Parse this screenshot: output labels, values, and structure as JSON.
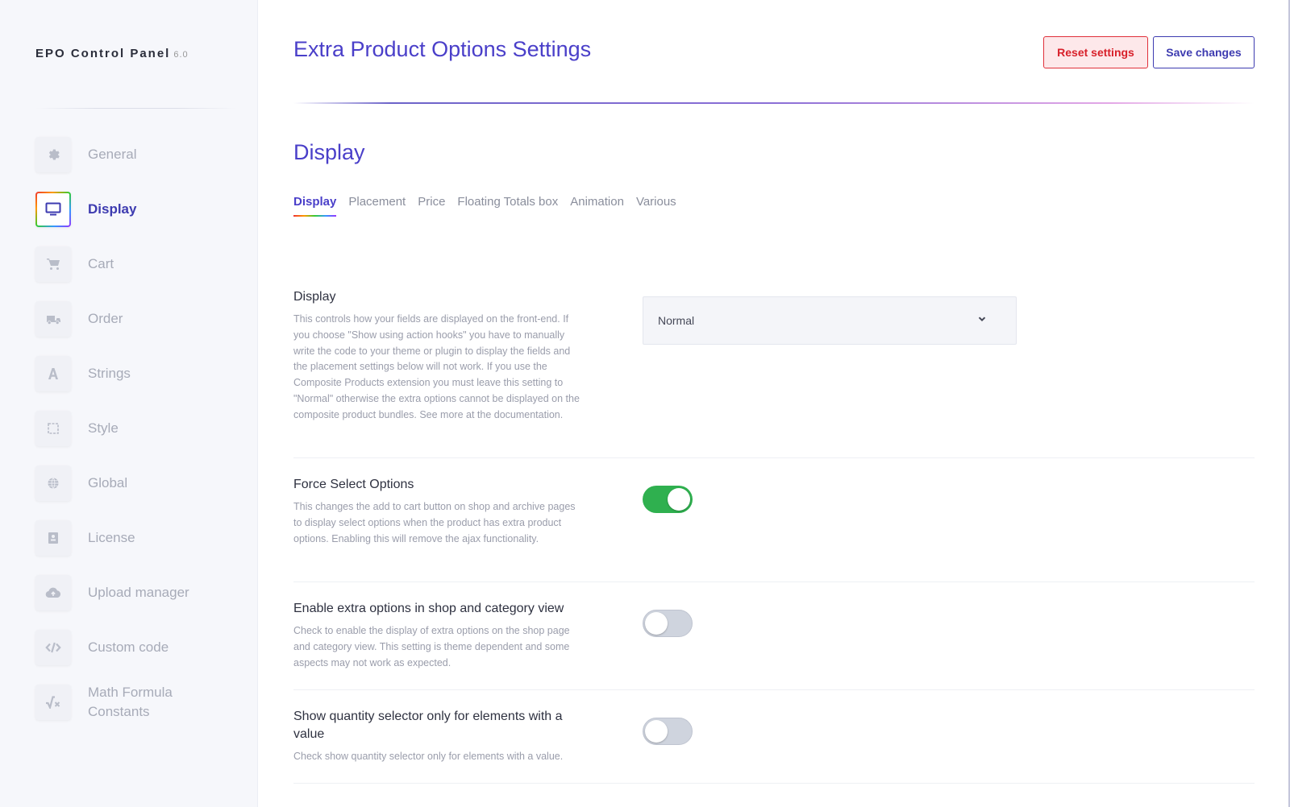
{
  "brand": {
    "name": "EPO Control Panel",
    "version": "6.0"
  },
  "sidebar": {
    "items": [
      {
        "label": "General",
        "icon": "gear-icon"
      },
      {
        "label": "Display",
        "icon": "monitor-icon",
        "active": true
      },
      {
        "label": "Cart",
        "icon": "cart-icon"
      },
      {
        "label": "Order",
        "icon": "truck-icon"
      },
      {
        "label": "Strings",
        "icon": "font-icon"
      },
      {
        "label": "Style",
        "icon": "square-icon"
      },
      {
        "label": "Global",
        "icon": "globe-icon"
      },
      {
        "label": "License",
        "icon": "license-icon"
      },
      {
        "label": "Upload manager",
        "icon": "cloud-upload-icon"
      },
      {
        "label": "Custom code",
        "icon": "code-icon"
      },
      {
        "label": "Math Formula\nConstants",
        "icon": "square-root-icon"
      }
    ]
  },
  "header": {
    "title": "Extra Product Options Settings",
    "reset_label": "Reset settings",
    "save_label": "Save changes"
  },
  "section": {
    "title": "Display",
    "tabs": [
      "Display",
      "Placement",
      "Price",
      "Floating Totals box",
      "Animation",
      "Various"
    ],
    "active_tab": "Display"
  },
  "settings": [
    {
      "title": "Display",
      "desc": "This controls how your fields are displayed on the front-end. If you choose \"Show using action hooks\" you have to manually write the code to your theme or plugin to display the fields and the placement settings below will not work. If you use the Composite Products extension you must leave this setting to \"Normal\" otherwise the extra options cannot be displayed on the composite product bundles. See more at the documentation.",
      "control": "select",
      "value": "Normal"
    },
    {
      "title": "Force Select Options",
      "desc": "This changes the add to cart button on shop and archive pages to display select options when the product has extra product options. Enabling this will remove the ajax functionality.",
      "control": "toggle",
      "value": true
    },
    {
      "title": "Enable extra options in shop and category view",
      "desc": "Check to enable the display of extra options on the shop page and category view. This setting is theme dependent and some aspects may not work as expected.",
      "control": "toggle",
      "value": false
    },
    {
      "title": "Show quantity selector only for elements with a value",
      "desc": "Check show quantity selector only for elements with a value.",
      "control": "toggle",
      "value": false
    }
  ],
  "colors": {
    "accent": "#4a3fc9",
    "toggle_on": "#2fb04f",
    "reset": "#d8202a"
  }
}
